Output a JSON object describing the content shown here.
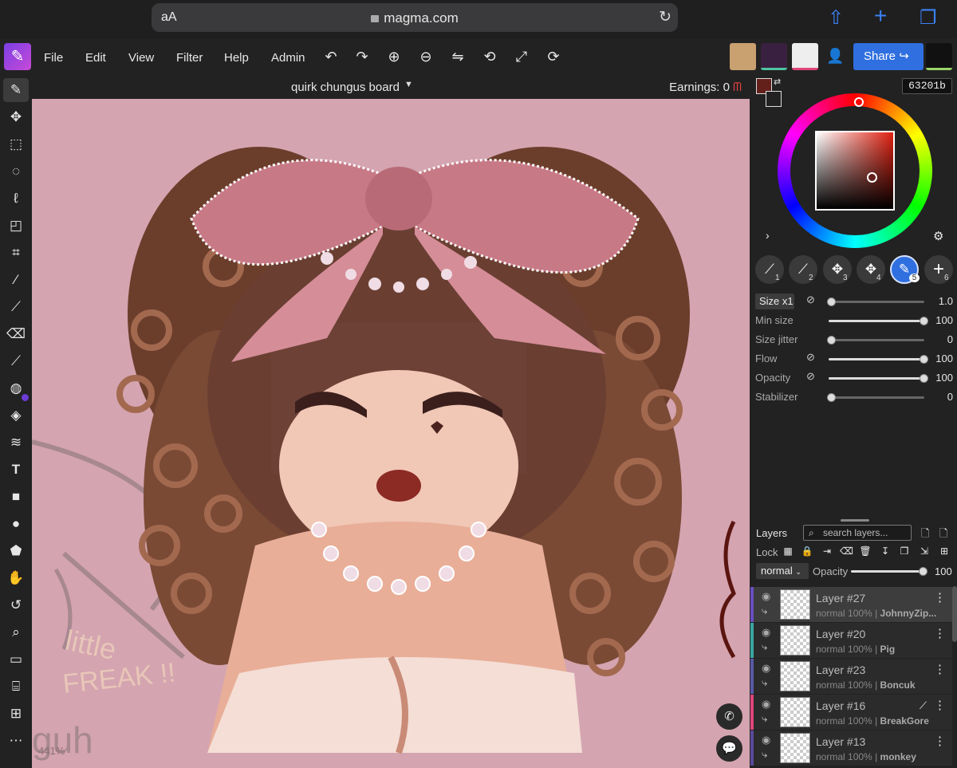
{
  "browser": {
    "text_size": "aA",
    "url": "magma.com"
  },
  "menubar": {
    "items": [
      "File",
      "Edit",
      "View",
      "Filter",
      "Help",
      "Admin"
    ],
    "share_label": "Share"
  },
  "board": {
    "name": "quirk chungus board",
    "earnings": "Earnings: 0"
  },
  "color": {
    "current_hex": "63201b",
    "foreground": "#63201b",
    "accent": "#2f6fe0"
  },
  "brush_presets": [
    "1",
    "2",
    "3",
    "4",
    "5",
    "6"
  ],
  "brush_params": [
    {
      "label": "Size x1",
      "value": "1.0"
    },
    {
      "label": "Min size",
      "value": "100"
    },
    {
      "label": "Size jitter",
      "value": "0"
    },
    {
      "label": "Flow",
      "value": "100"
    },
    {
      "label": "Opacity",
      "value": "100"
    },
    {
      "label": "Stabilizer",
      "value": "0"
    }
  ],
  "layers_panel": {
    "title": "Layers",
    "search_placeholder": "search layers...",
    "lock_label": "Lock",
    "blend_mode": "normal",
    "opacity_label": "Opacity",
    "opacity_value": "100",
    "layers": [
      {
        "name": "Layer #27",
        "mode": "normal",
        "opacity": "100%",
        "owner": "JohnnyZip...",
        "color": "#6a4fbf"
      },
      {
        "name": "Layer #20",
        "mode": "normal",
        "opacity": "100%",
        "owner": "Pig",
        "color": "#3aa6a0"
      },
      {
        "name": "Layer #23",
        "mode": "normal",
        "opacity": "100%",
        "owner": "Boncuk",
        "color": "#5a5aa8"
      },
      {
        "name": "Layer #16",
        "mode": "normal",
        "opacity": "100%",
        "owner": "BreakGore",
        "color": "#e0457b"
      },
      {
        "name": "Layer #13",
        "mode": "normal",
        "opacity": "100%",
        "owner": "monkey",
        "color": "#5a4a9a"
      }
    ]
  },
  "canvas": {
    "zoom": "441%",
    "scribble_text": [
      "little",
      "FREAK !!",
      "guh"
    ]
  }
}
